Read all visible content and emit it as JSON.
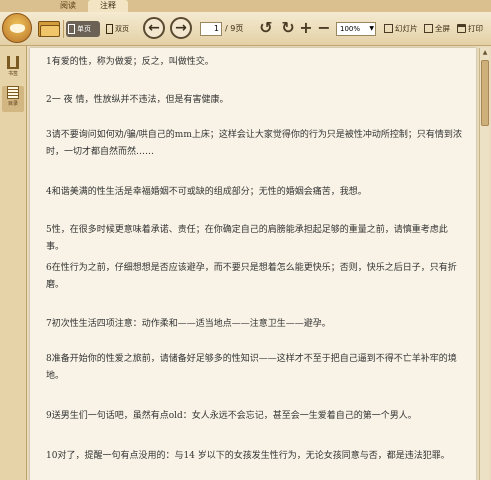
{
  "tabs": [
    {
      "label": "阅读"
    },
    {
      "label": "注释"
    }
  ],
  "toolbar": {
    "single_page_label": "单页",
    "double_page_label": "双页",
    "prev_symbol": "←",
    "next_symbol": "→",
    "page_current": "1",
    "page_total": "/ 9页",
    "zoom_in_symbol": "+",
    "zoom_out_symbol": "−",
    "zoom_value": "100%",
    "slideshow_label": "幻灯片",
    "fullscreen_label": "全屏",
    "print_label": "打印"
  },
  "sidebar": {
    "items": [
      {
        "label": "书签"
      },
      {
        "label": "目录"
      }
    ]
  },
  "content": {
    "paragraphs": [
      "1有爱的性，称为做爱；反之，叫做性交。",
      "2一 夜  情，性放纵并不违法，但是有害健康。",
      "3请不要询问如何劝/骗/哄自己的mm上床；这样会让大家觉得你的行为只是被性冲动所控制；只有情到浓时，一切才都自然而然……",
      "4和谐美满的性生活是幸福婚姻不可或缺的组成部分；无性的婚姻会痛苦，我想。",
      "5性，在很多时候更意味着承诺、责任；在你确定自己的肩膀能承担起足够的重量之前，请慎重考虑此事。",
      "6在性行为之前，仔细想想是否应该避孕，而不要只是想着怎么能更快乐；否则，快乐之后日子，只有折磨。",
      "7初次性生活四项注意：动作柔和——适当地点——注意卫生——避孕。",
      "8准备开始你的性爱之旅前，请储备好足够多的性知识——这样才不至于把自己逼到不得不亡羊补牢的境地。",
      "9送男生们一句话吧，虽然有点old：女人永远不会忘记，甚至会一生爱着自己的第一个男人。",
      "10对了，提醒一句有点没用的：与14 岁以下的女孩发生性行为，无论女孩同意与否，都是违法犯罪。"
    ]
  }
}
